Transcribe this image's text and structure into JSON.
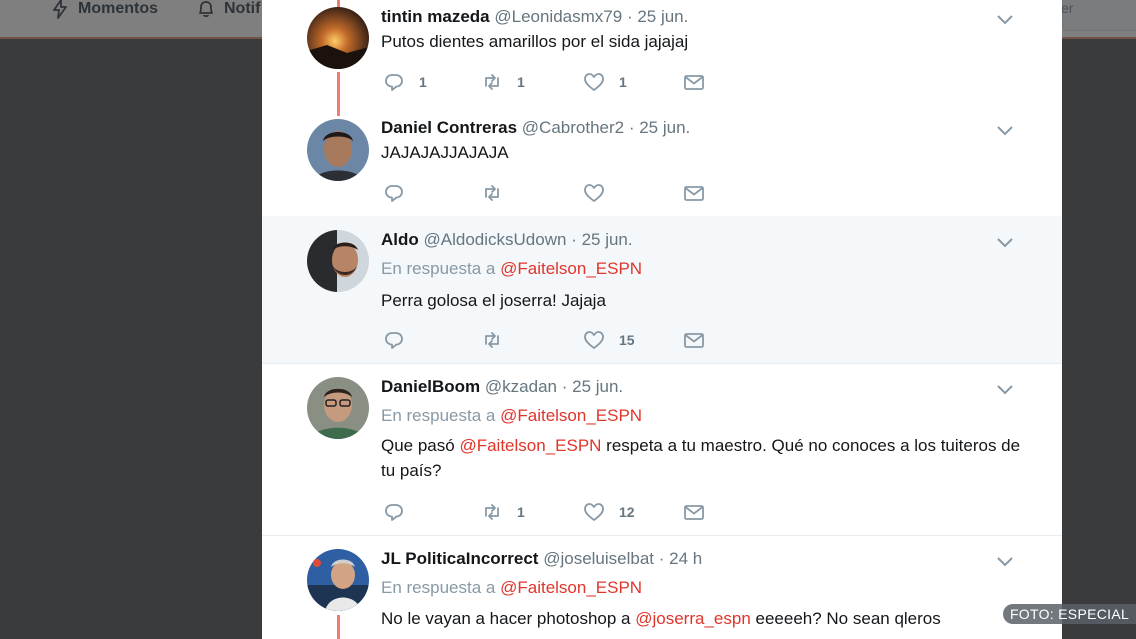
{
  "nav": {
    "moments_label": "Momentos",
    "notifications_label": "Notif",
    "search_partial": "er"
  },
  "tweets": [
    {
      "name": "tintin mazeda",
      "handle": "@Leonidasmx79",
      "date": "· 25 jun.",
      "text": "Putos dientes amarillos por el sida jajajaj",
      "reply_count": "1",
      "retweet_count": "1",
      "like_count": "1"
    },
    {
      "name": "Daniel Contreras",
      "handle": "@Cabrother2",
      "date": "· 25 jun.",
      "text": "JAJAJAJJAJAJA",
      "reply_count": "",
      "retweet_count": "",
      "like_count": ""
    },
    {
      "name": "Aldo",
      "handle": "@AldodicksUdown",
      "date": "· 25 jun.",
      "reply_prefix": "En respuesta a",
      "reply_mention": "@Faitelson_ESPN",
      "text": "Perra golosa el joserra! Jajaja",
      "reply_count": "",
      "retweet_count": "",
      "like_count": "15"
    },
    {
      "name": "DanielBoom",
      "handle": "@kzadan",
      "date": "· 25 jun.",
      "reply_prefix": "En respuesta a",
      "reply_mention": "@Faitelson_ESPN",
      "text_before": "Que pasó ",
      "text_mention": "@Faitelson_ESPN",
      "text_after": " respeta a tu maestro. Qué no conoces a los tuiteros de tu país?",
      "reply_count": "",
      "retweet_count": "1",
      "like_count": "12"
    },
    {
      "name": "JL PoliticaIncorrect",
      "handle": "@joseluiselbat",
      "date": "· 24 h",
      "reply_prefix": "En respuesta a",
      "reply_mention": "@Faitelson_ESPN",
      "text_before": "No le vayan a hacer photoshop a ",
      "text_mention": "@joserra_espn",
      "text_after": " eeeeeh? No sean qleros"
    }
  ],
  "credit": "FOTO: ESPECIAL",
  "colors": {
    "accent": "#e0352b",
    "thread": "#f27a6e",
    "muted": "#66757f",
    "overlay": "#757678"
  }
}
